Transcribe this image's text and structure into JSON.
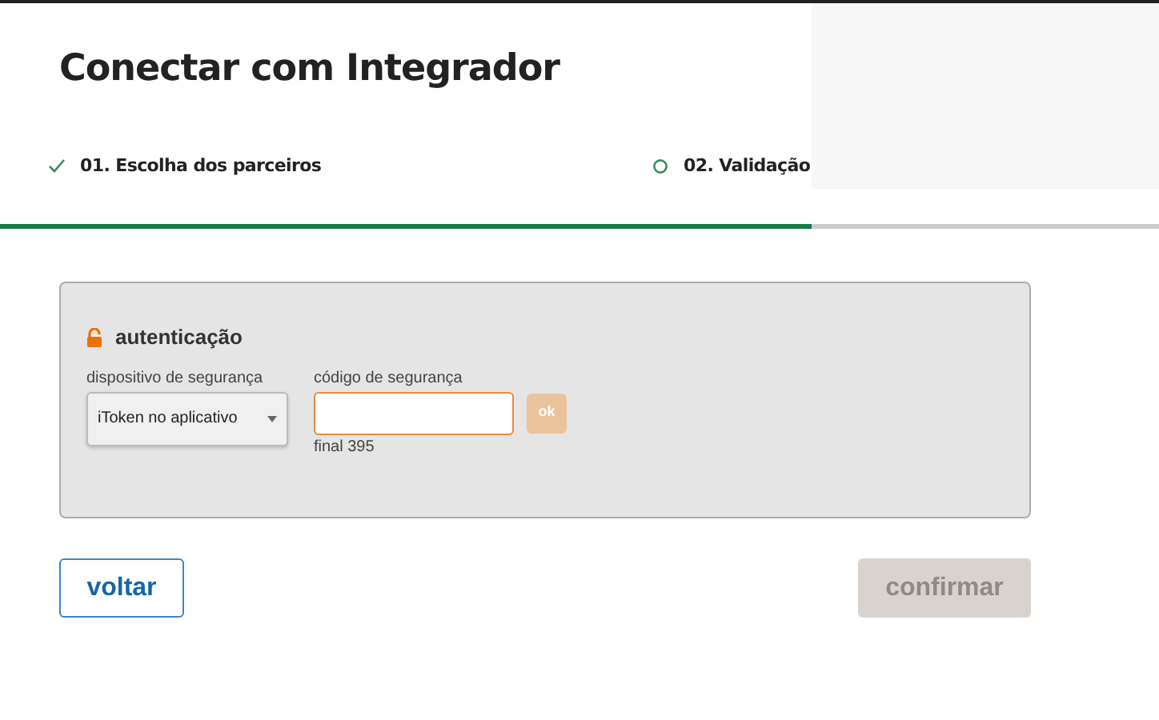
{
  "title": "Conectar com Integrador",
  "steps": [
    {
      "label": "01. Escolha dos parceiros",
      "done": true
    },
    {
      "label": "02. Validação",
      "done": false
    }
  ],
  "progress": {
    "level": 0.7
  },
  "auth": {
    "title": "autenticação",
    "device": {
      "label": "dispositivo de segurança",
      "value": "iToken no aplicativo"
    },
    "code": {
      "label": "código de segurança",
      "hint": "final 395",
      "focused": true
    },
    "ok_button": {
      "label": "ok",
      "disabled": true
    }
  },
  "buttons": [
    {
      "label": "voltar",
      "kind": "outline"
    },
    {
      "label": "confirmar",
      "kind": "primary",
      "disabled": true
    }
  ]
}
